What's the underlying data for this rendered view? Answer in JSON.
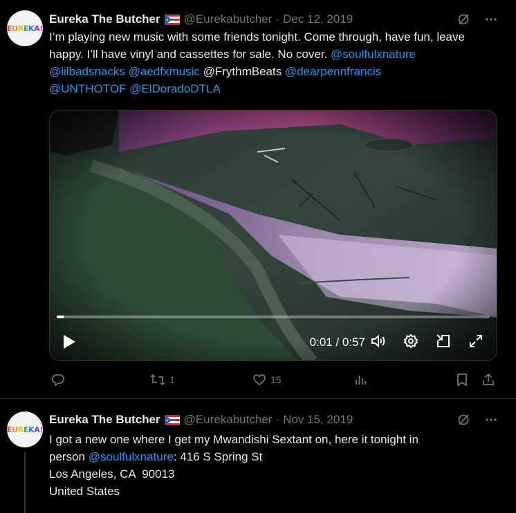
{
  "tweets": [
    {
      "avatar_text": [
        "E",
        "U",
        "R",
        "E",
        "K",
        "A",
        "!"
      ],
      "name": "Eureka The Butcher",
      "handle": "@Eurekabutcher",
      "separator": "·",
      "date": "Dec 12, 2019",
      "text_plain": "I’m playing new music with some friends tonight. Come through, have fun, leave happy. I’ll have vinyl and cassettes for sale. No cover. ",
      "mentions": [
        "@soulfulxnature",
        "@lilbadsnacks",
        "@aedfxmusic",
        "@FrythmBeats",
        "@dearpennfrancis",
        "@UNTHOTOF",
        "@ElDoradoDTLA"
      ],
      "video": {
        "current_time": "0:01",
        "duration": "0:57",
        "time_display": "0:01 / 0:57",
        "progress": 0.017
      },
      "stats": {
        "replies": "",
        "reposts": "1",
        "likes": "15"
      }
    },
    {
      "avatar_text": [
        "E",
        "U",
        "R",
        "E",
        "K",
        "A",
        "!"
      ],
      "name": "Eureka The Butcher",
      "handle": "@Eurekabutcher",
      "separator": "·",
      "date": "Nov 15, 2019",
      "line1": "I got a new one where I get my Mwandishi Sextant on, here it tonight in",
      "line2_prefix": "person ",
      "line2_mention": "@soulfulxnature",
      "line2_suffix": ": 416 S Spring St",
      "line3": "Los Angeles, CA  90013",
      "line4": "United States"
    }
  ],
  "colors": {
    "accent": "#1d9bf0",
    "muted": "#71767b",
    "text": "#e7e9ea",
    "background": "#000000"
  }
}
